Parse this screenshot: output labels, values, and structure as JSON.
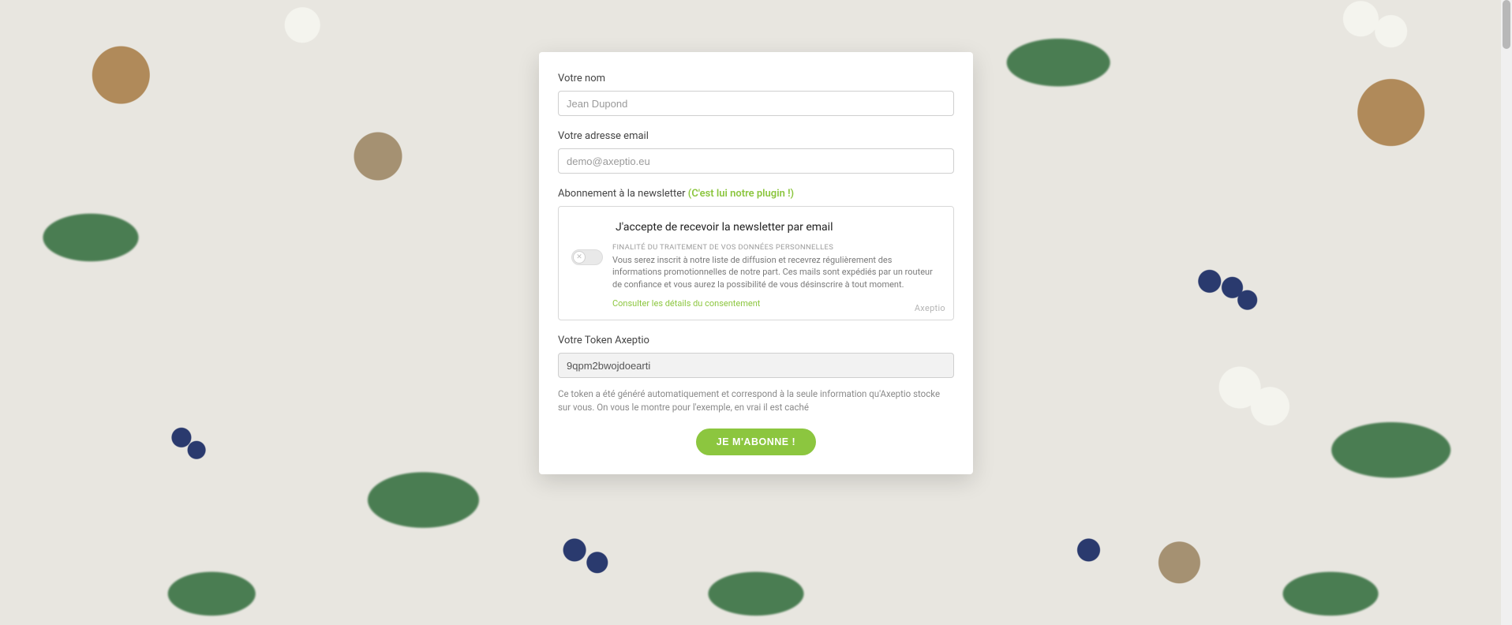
{
  "form": {
    "name": {
      "label": "Votre nom",
      "placeholder": "Jean Dupond"
    },
    "email": {
      "label": "Votre adresse email",
      "placeholder": "demo@axeptio.eu"
    },
    "newsletter": {
      "label": "Abonnement à la newsletter",
      "highlight": "(C'est lui notre plugin !)"
    },
    "consent": {
      "title": "J'accepte de recevoir la newsletter par email",
      "meta": "FINALITÉ DU TRAITEMENT DE VOS DONNÉES PERSONNELLES",
      "desc": "Vous serez inscrit à notre liste de diffusion et recevrez régulièrement des informations promotionnelles de notre part. Ces mails sont expédiés par un routeur de confiance et vous aurez la possibilité de vous désinscrire à tout moment.",
      "link": "Consulter les détails du consentement",
      "brand": "Axeptio"
    },
    "token": {
      "label": "Votre Token Axeptio",
      "value": "9qpm2bwojdoearti",
      "helper": "Ce token a été généré automatiquement et correspond à la seule information qu'Axeptio stocke sur vous. On vous le montre pour l'exemple, en vrai il est caché"
    },
    "submit": "JE M'ABONNE !"
  }
}
